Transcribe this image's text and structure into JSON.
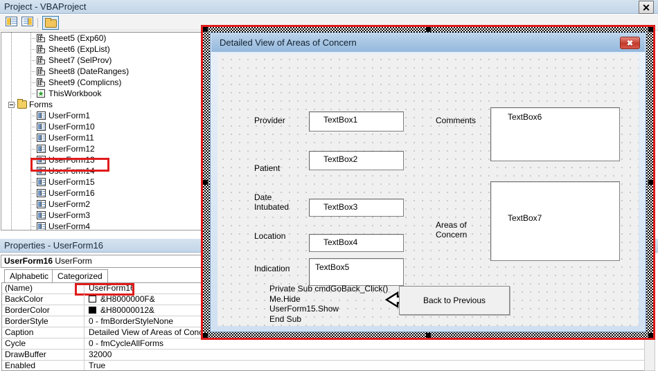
{
  "window": {
    "project_title": "Project - VBAProject",
    "close_label": "✕"
  },
  "toolbar": {
    "buttons": [
      {
        "name": "view-code-button",
        "label": "View Code"
      },
      {
        "name": "view-object-button",
        "label": "View Object"
      },
      {
        "name": "toggle-folders-button",
        "label": "Toggle Folders"
      }
    ]
  },
  "tree": {
    "items": [
      {
        "label": "Sheet5 (Exp60)",
        "icon": "sheet-icon",
        "indent": 2,
        "expander": false
      },
      {
        "label": "Sheet6 (ExpList)",
        "icon": "sheet-icon",
        "indent": 2,
        "expander": false
      },
      {
        "label": "Sheet7 (SelProv)",
        "icon": "sheet-icon",
        "indent": 2,
        "expander": false
      },
      {
        "label": "Sheet8 (DateRanges)",
        "icon": "sheet-icon",
        "indent": 2,
        "expander": false
      },
      {
        "label": "Sheet9 (Complicns)",
        "icon": "sheet-icon",
        "indent": 2,
        "expander": false
      },
      {
        "label": "ThisWorkbook",
        "icon": "workbook-icon",
        "indent": 2,
        "expander": false
      },
      {
        "label": "Forms",
        "icon": "folder-icon",
        "indent": 1,
        "expander": true
      },
      {
        "label": "UserForm1",
        "icon": "userform-icon",
        "indent": 2,
        "expander": false
      },
      {
        "label": "UserForm10",
        "icon": "userform-icon",
        "indent": 2,
        "expander": false
      },
      {
        "label": "UserForm11",
        "icon": "userform-icon",
        "indent": 2,
        "expander": false
      },
      {
        "label": "UserForm12",
        "icon": "userform-icon",
        "indent": 2,
        "expander": false
      },
      {
        "label": "UserForm13",
        "icon": "userform-icon",
        "indent": 2,
        "expander": false
      },
      {
        "label": "UserForm14",
        "icon": "userform-icon",
        "indent": 2,
        "expander": false
      },
      {
        "label": "UserForm15",
        "icon": "userform-icon",
        "indent": 2,
        "expander": false
      },
      {
        "label": "UserForm16",
        "icon": "userform-icon",
        "indent": 2,
        "expander": false
      },
      {
        "label": "UserForm2",
        "icon": "userform-icon",
        "indent": 2,
        "expander": false
      },
      {
        "label": "UserForm3",
        "icon": "userform-icon",
        "indent": 2,
        "expander": false
      },
      {
        "label": "UserForm4",
        "icon": "userform-icon",
        "indent": 2,
        "expander": false
      }
    ],
    "highlighted_item": "UserForm16",
    "highlight_color": "#e01b1b"
  },
  "properties": {
    "title": "Properties - UserForm16",
    "object_name": "UserForm16",
    "object_type": "UserForm",
    "tabs": [
      {
        "label": "Alphabetic",
        "active": true
      },
      {
        "label": "Categorized",
        "active": false
      }
    ],
    "rows": [
      {
        "name": "(Name)",
        "value": "UserForm16",
        "swatch": null,
        "highlighted": true
      },
      {
        "name": "BackColor",
        "value": "&H8000000F&",
        "swatch": "#ffffff",
        "highlighted": false
      },
      {
        "name": "BorderColor",
        "value": "&H80000012&",
        "swatch": "#000000",
        "highlighted": false
      },
      {
        "name": "BorderStyle",
        "value": "0 - fmBorderStyleNone",
        "swatch": null,
        "highlighted": false
      },
      {
        "name": "Caption",
        "value": "Detailed View of Areas of Concern",
        "swatch": null,
        "highlighted": false
      },
      {
        "name": "Cycle",
        "value": "0 - fmCycleAllForms",
        "swatch": null,
        "highlighted": false
      },
      {
        "name": "DrawBuffer",
        "value": "32000",
        "swatch": null,
        "highlighted": false
      },
      {
        "name": "Enabled",
        "value": "True",
        "swatch": null,
        "highlighted": false
      }
    ]
  },
  "designer": {
    "caption": "Detailed View of Areas of Concern",
    "close_label": "✖",
    "annotation_color": "#e01b1b",
    "labels": [
      {
        "name": "provider-label",
        "text": "Provider"
      },
      {
        "name": "patient-label",
        "text": "Patient"
      },
      {
        "name": "date-intubated-label",
        "text": "Date\nIntubated"
      },
      {
        "name": "location-label",
        "text": "Location"
      },
      {
        "name": "indication-label",
        "text": "Indication"
      },
      {
        "name": "comments-label",
        "text": "Comments"
      },
      {
        "name": "areas-of-concern-label",
        "text": "Areas of\nConcern"
      }
    ],
    "textboxes": [
      {
        "name": "textbox1",
        "text": "TextBox1"
      },
      {
        "name": "textbox2",
        "text": "TextBox2"
      },
      {
        "name": "textbox3",
        "text": "TextBox3"
      },
      {
        "name": "textbox4",
        "text": "TextBox4"
      },
      {
        "name": "textbox5",
        "text": "TextBox5"
      },
      {
        "name": "textbox6",
        "text": "TextBox6"
      },
      {
        "name": "textbox7",
        "text": "TextBox7"
      }
    ],
    "button": {
      "name": "back-to-previous-button",
      "label": "Back to Previous"
    },
    "code_annotation": "Private Sub cmdGoBack_Click()\nMe.Hide\nUserForm15.Show\nEnd Sub"
  }
}
